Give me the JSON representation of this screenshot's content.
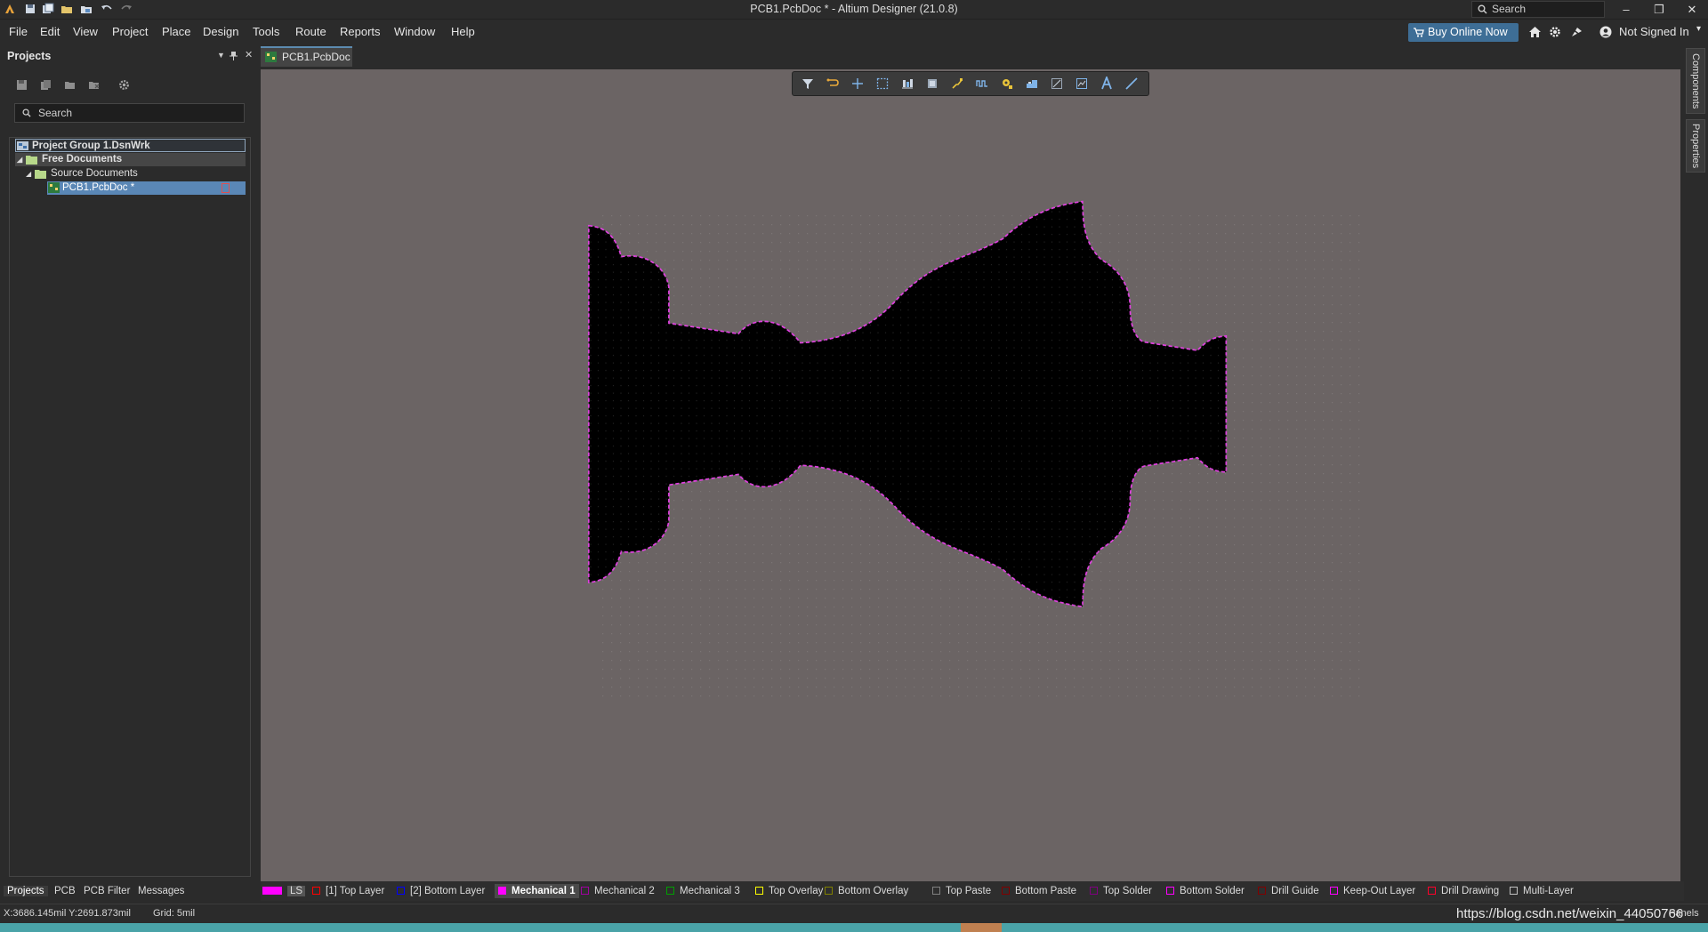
{
  "window": {
    "title": "PCB1.PcbDoc * - Altium Designer (21.0.8)",
    "search_placeholder": "Search",
    "minimize": "–",
    "restore": "❐",
    "close": "✕"
  },
  "menu": [
    "File",
    "Edit",
    "View",
    "Project",
    "Place",
    "Design",
    "Tools",
    "Route",
    "Reports",
    "Window",
    "Help"
  ],
  "menu_right": {
    "buy": "Buy Online Now",
    "user": "Not Signed In"
  },
  "panel": {
    "title": "Projects",
    "search_placeholder": "Search",
    "tree": [
      {
        "label": "Project Group 1.DsnWrk",
        "bold": true
      },
      {
        "label": "Free Documents",
        "bold": true
      },
      {
        "label": "Source Documents",
        "bold": false
      },
      {
        "label": "PCB1.PcbDoc *",
        "bold": false,
        "selected": true
      }
    ]
  },
  "document_tab": "PCB1.PcbDoc *",
  "right_tabs": [
    "Components",
    "Properties"
  ],
  "bottom_tabs": [
    "Projects",
    "PCB",
    "PCB Filter",
    "Messages"
  ],
  "layers": [
    {
      "name": "LS",
      "color": "#ff00ff",
      "active": false
    },
    {
      "name": "[1] Top Layer",
      "color": "#ff0000",
      "active": false
    },
    {
      "name": "[2] Bottom Layer",
      "color": "#0000ff",
      "active": false
    },
    {
      "name": "Mechanical 1",
      "color": "#ff00ff",
      "active": true
    },
    {
      "name": "Mechanical 2",
      "color": "#a000a0",
      "active": false
    },
    {
      "name": "Mechanical 3",
      "color": "#00a000",
      "active": false
    },
    {
      "name": "Top Overlay",
      "color": "#ffff00",
      "active": false
    },
    {
      "name": "Bottom Overlay",
      "color": "#808000",
      "active": false
    },
    {
      "name": "Top Paste",
      "color": "#808080",
      "active": false
    },
    {
      "name": "Bottom Paste",
      "color": "#800000",
      "active": false
    },
    {
      "name": "Top Solder",
      "color": "#800080",
      "active": false
    },
    {
      "name": "Bottom Solder",
      "color": "#ff00ff",
      "active": false
    },
    {
      "name": "Drill Guide",
      "color": "#800000",
      "active": false
    },
    {
      "name": "Keep-Out Layer",
      "color": "#ff00ff",
      "active": false
    },
    {
      "name": "Drill Drawing",
      "color": "#ff002a",
      "active": false
    },
    {
      "name": "Multi-Layer",
      "color": "#c0c0c0",
      "active": false
    }
  ],
  "status": {
    "coords": "X:3686.145mil Y:2691.873mil",
    "grid": "Grid: 5mil",
    "watermark": "https://blog.csdn.net/weixin_44050766",
    "panels": "Panels"
  },
  "colors": {
    "board": "#000000",
    "outline": "#e040e0",
    "canvas": "#6b6464",
    "accent": "#3e6e96"
  }
}
